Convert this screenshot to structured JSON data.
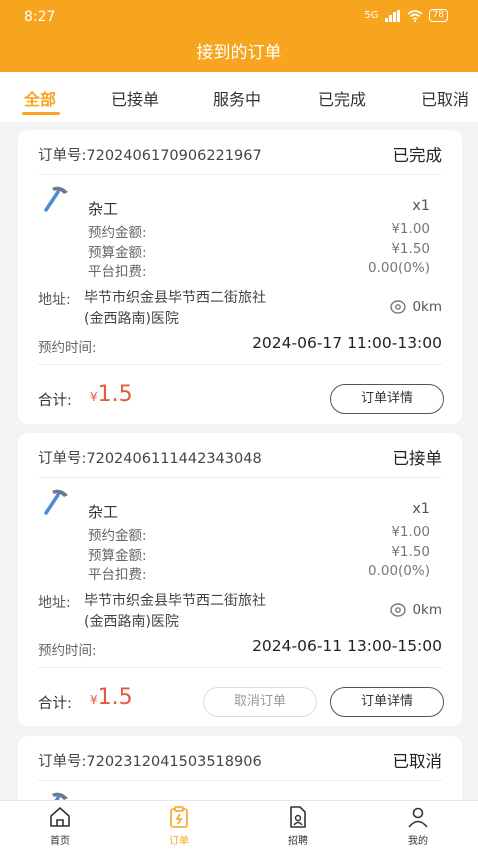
{
  "status_bar": {
    "time": "8:27",
    "signal": "5G",
    "battery": "78"
  },
  "header": {
    "title": "接到的订单"
  },
  "tabs": [
    {
      "label": "全部",
      "active": true
    },
    {
      "label": "已接单",
      "active": false
    },
    {
      "label": "服务中",
      "active": false
    },
    {
      "label": "已完成",
      "active": false
    },
    {
      "label": "已取消",
      "active": false
    }
  ],
  "labels": {
    "order_prefix": "订单号:",
    "booking_amount": "预约金额:",
    "budget_amount": "预算金额:",
    "platform_fee": "平台扣费:",
    "address": "地址:",
    "booking_time": "预约时间:",
    "total": "合计:",
    "yen": "¥",
    "detail_button": "订单详情",
    "cancel_button": "取消订单"
  },
  "orders": [
    {
      "order_no": "订单号:7202406170906221967",
      "status": "已完成",
      "service": "杂工",
      "qty": "x1",
      "booking_amount": "¥1.00",
      "budget_amount": "¥1.50",
      "platform_fee": "0.00(0%)",
      "address_line1": "毕节市织金县毕节西二街旅社",
      "address_line2": "(金西路南)医院",
      "distance": "0km",
      "time": "2024-06-17 11:00-13:00",
      "total": "1.5"
    },
    {
      "order_no": "订单号:7202406111442343048",
      "status": "已接单",
      "service": "杂工",
      "qty": "x1",
      "booking_amount": "¥1.00",
      "budget_amount": "¥1.50",
      "platform_fee": "0.00(0%)",
      "address_line1": "毕节市织金县毕节西二街旅社",
      "address_line2": "(金西路南)医院",
      "distance": "0km",
      "time": "2024-06-11 13:00-15:00",
      "total": "1.5"
    },
    {
      "order_no": "订单号:7202312041503518906",
      "status": "已取消"
    }
  ],
  "nav": [
    {
      "label": "首页",
      "icon": "home-icon",
      "active": false
    },
    {
      "label": "订单",
      "icon": "order-icon",
      "active": true
    },
    {
      "label": "招聘",
      "icon": "recruit-icon",
      "active": false
    },
    {
      "label": "我的",
      "icon": "profile-icon",
      "active": false
    }
  ],
  "colors": {
    "accent": "#f7a41e",
    "price": "#e25a3b"
  }
}
